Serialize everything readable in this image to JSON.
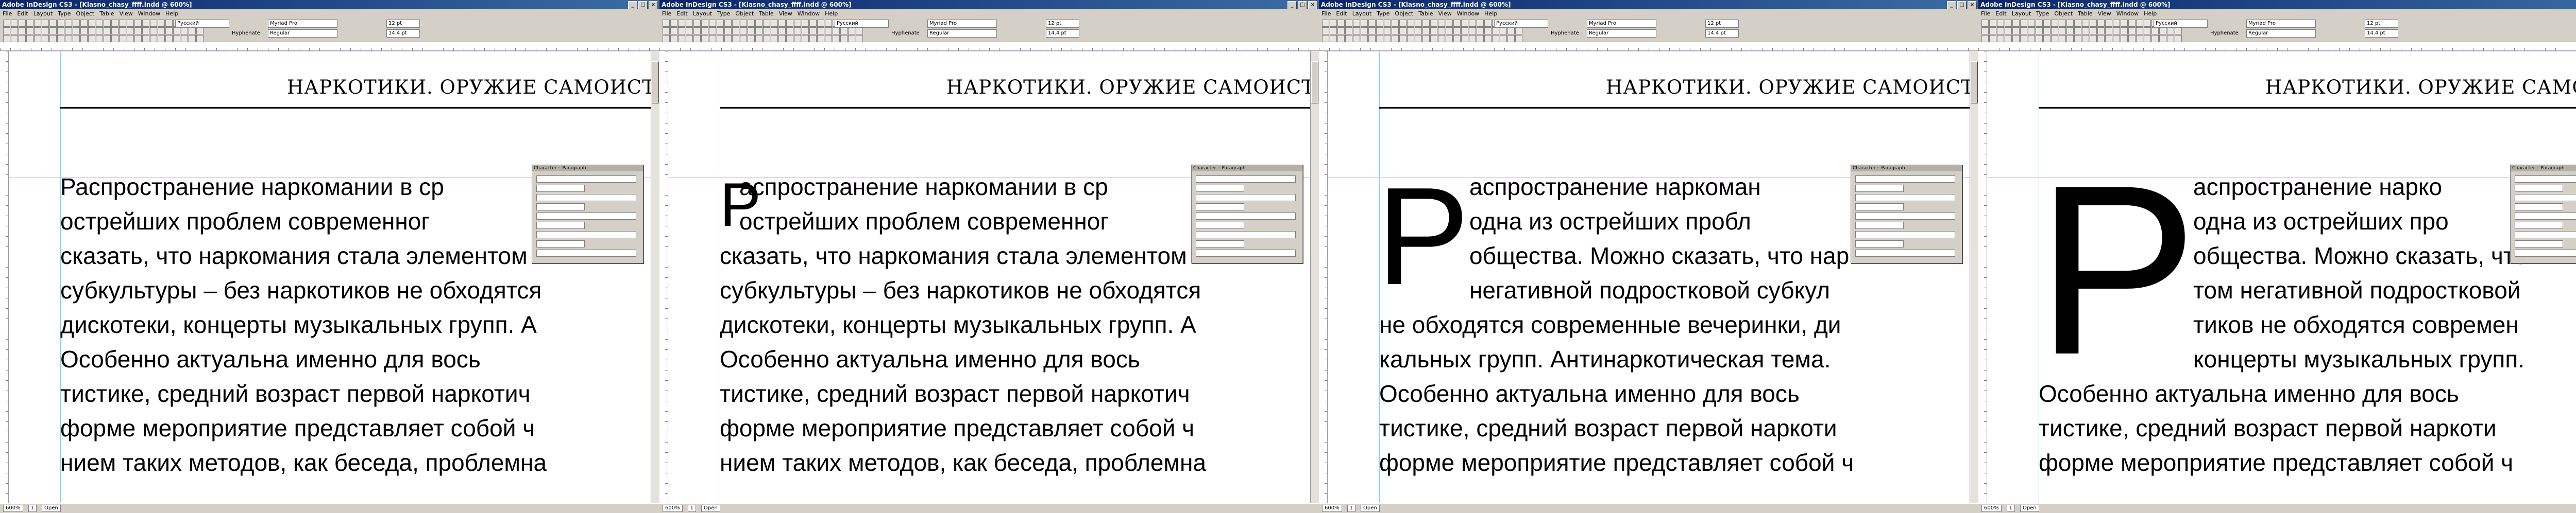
{
  "window": {
    "title": "Adobe InDesign CS3 - [Klasno_chasy_ffff.indd @ 600%]",
    "buttons": [
      "_",
      "□",
      "×"
    ]
  },
  "menu": [
    "File",
    "Edit",
    "Layout",
    "Type",
    "Object",
    "Table",
    "View",
    "Window",
    "Help"
  ],
  "control": {
    "font_family": "Myriad Pro",
    "font_style": "Regular",
    "size": "12 pt",
    "leading": "14.4 pt",
    "language": "Русский",
    "hyphenate_label": "Hyphenate"
  },
  "document": {
    "running_header": "НАРКОТИКИ. ОРУЖИЕ САМОИСТ",
    "lines_plain": [
      "Распространение наркомании в ср",
      "острейших проблем современног",
      "сказать, что наркомания стала элементом н",
      "субкультуры – без наркотиков не обходятся",
      "дискотеки, концерты музыкальных групп. А",
      "    Особенно актуальна именно для вось",
      "тистике, средний возраст первой наркотич",
      "форме мероприятие представляет собой ч",
      "нием таких методов, как беседа, проблемна"
    ],
    "lines_cap2": [
      "аспространение наркомании в ср",
      "острейших проблем современног",
      "сказать, что наркомания стала элементом н",
      "субкультуры – без наркотиков не обходятся",
      "дискотеки, концерты музыкальных групп. А",
      "    Особенно актуальна именно для вось",
      "тистике, средний возраст первой наркотич",
      "форме мероприятие представляет собой ч",
      "нием таких методов, как беседа, проблемна"
    ],
    "lines_cap3_indented": [
      "аспространение наркоман",
      "одна из острейших пробл",
      "общества. Можно сказать, что нар",
      "негативной подростковой субкул"
    ],
    "lines_cap3_full": [
      "не обходятся современные вечеринки, ди",
      "кальных групп. Антинаркотическая тема.",
      "    Особенно актуальна именно для вось",
      "тистике, средний возраст первой наркоти",
      "форме мероприятие представляет собой ч"
    ],
    "lines_cap4_indented": [
      "аспространение нарко",
      "одна из острейших про",
      "общества. Можно сказать, что н",
      "том негативной подростковой",
      "тиков не обходятся современ",
      "концерты музыкальных групп."
    ],
    "lines_cap4_full": [
      "    Особенно актуальна именно для вось",
      "тистике, средний возраст первой наркоти",
      "форме мероприятие представляет собой ч"
    ],
    "drop_cap": "Р"
  },
  "panel": {
    "title": "Character ◦ Paragraph"
  },
  "status": {
    "zoom": "600%",
    "page": "1",
    "state": "Open"
  }
}
